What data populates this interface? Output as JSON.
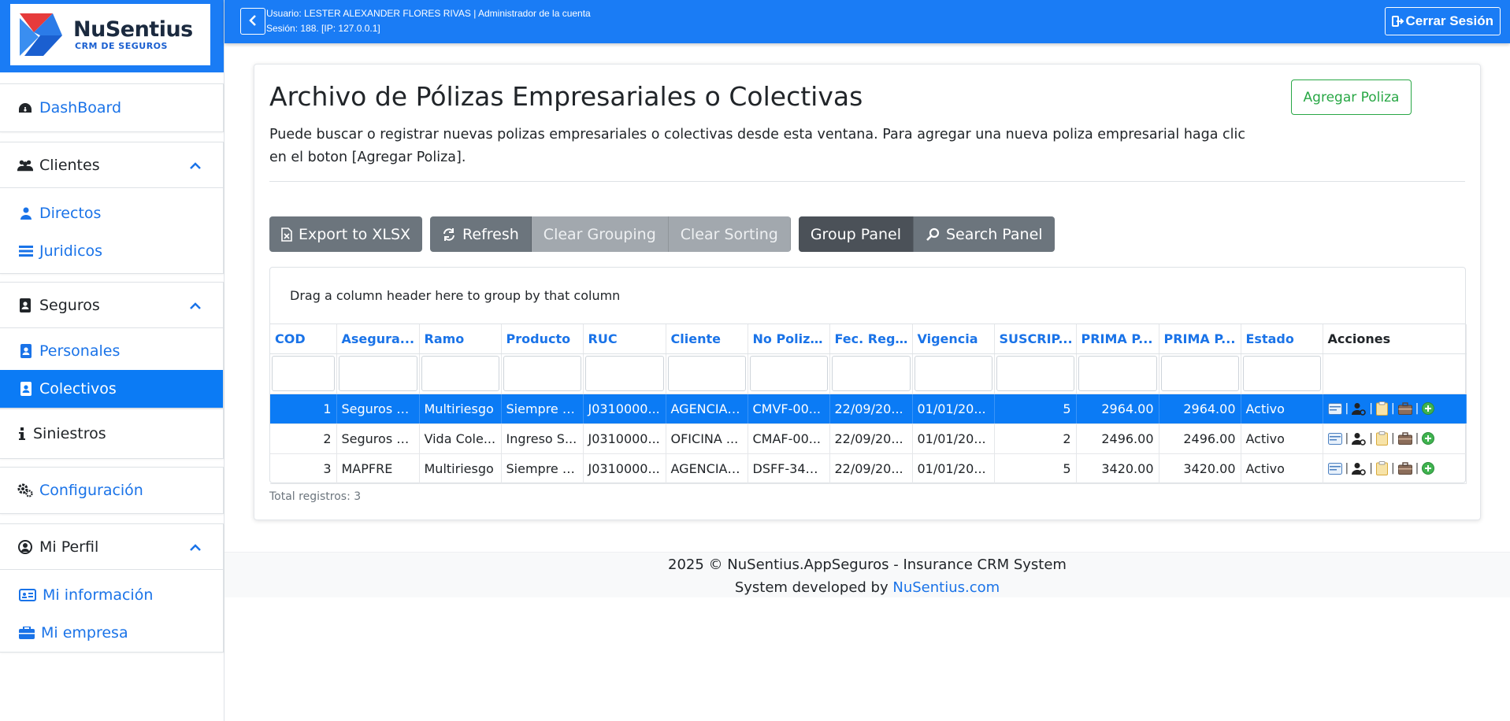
{
  "brand": {
    "name": "NuSentius",
    "tagline": "CRM DE SEGUROS"
  },
  "colors": {
    "primary": "#1a7cf5",
    "active": "#0b7bf5",
    "success": "#28a745",
    "link": "#1a73e8"
  },
  "sidebar": {
    "dashboard": {
      "label": "DashBoard",
      "icon": "dashboard-icon"
    },
    "clientes": {
      "label": "Clientes",
      "icon": "users-icon",
      "items": [
        {
          "label": "Directos",
          "icon": "user-icon"
        },
        {
          "label": "Juridicos",
          "icon": "list-icon"
        }
      ]
    },
    "seguros": {
      "label": "Seguros",
      "icon": "contact-book-icon",
      "items": [
        {
          "label": "Personales",
          "icon": "person-badge-icon"
        },
        {
          "label": "Colectivos",
          "icon": "person-badge-icon",
          "active": true
        }
      ]
    },
    "siniestros": {
      "label": "Siniestros",
      "icon": "info-icon"
    },
    "configuracion": {
      "label": "Configuración",
      "icon": "gears-icon"
    },
    "perfil": {
      "label": "Mi Perfil",
      "icon": "user-circle-icon",
      "items": [
        {
          "label": "Mi información",
          "icon": "id-card-icon"
        },
        {
          "label": "Mi empresa",
          "icon": "briefcase-icon"
        }
      ]
    }
  },
  "topbar": {
    "user_line": "Usuario: LESTER ALEXANDER FLORES RIVAS | Administrador de la cuenta",
    "session_line": "Sesión: 188. [IP: 127.0.0.1]",
    "logout_label": "Cerrar Sesión"
  },
  "main": {
    "title": "Archivo de Pólizas Empresariales o Colectivas",
    "description": "Puede buscar o registrar nuevas polizas empresariales o colectivas desde esta ventana. Para agregar una nueva poliza empresarial haga clic en el boton [Agregar Poliza].",
    "add_button": "Agregar Poliza",
    "toolbar": {
      "export": "Export to XLSX",
      "refresh": "Refresh",
      "clear_grouping": "Clear Grouping",
      "clear_sorting": "Clear Sorting",
      "group_panel": "Group Panel",
      "search_panel": "Search Panel"
    },
    "group_panel_text": "Drag a column header here to group by that column",
    "columns": [
      "COD",
      "Asegura...",
      "Ramo",
      "Producto",
      "RUC",
      "Cliente",
      "No Poliza...",
      "Fec. Regi...",
      "Vigencia",
      "SUSCRIP...",
      "PRIMA P...",
      "PRIMA P...",
      "Estado",
      "Acciones"
    ],
    "rows": [
      {
        "cod": "1",
        "aseguradora": "Seguros A...",
        "ramo": "Multiriesgo",
        "producto": "Siempre S...",
        "ruc": "J0310000...",
        "cliente": "AGENCIA ...",
        "poliza": "CMVF-00...",
        "fecha": "22/09/20...",
        "vigencia": "01/01/20...",
        "suscrip": "5",
        "prima1": "2964.00",
        "prima2": "2964.00",
        "estado": "Activo"
      },
      {
        "cod": "2",
        "aseguradora": "Seguros A...",
        "ramo": "Vida Cole...",
        "producto": "Ingreso S...",
        "ruc": "J0310000...",
        "cliente": "OFICINA ...",
        "poliza": "CMAF-00...",
        "fecha": "22/09/20...",
        "vigencia": "01/01/20...",
        "suscrip": "2",
        "prima1": "2496.00",
        "prima2": "2496.00",
        "estado": "Activo"
      },
      {
        "cod": "3",
        "aseguradora": "MAPFRE",
        "ramo": "Multiriesgo",
        "producto": "Siempre S...",
        "ruc": "J0310000...",
        "cliente": "AGENCIA ...",
        "poliza": "DSFF-345...",
        "fecha": "22/09/20...",
        "vigencia": "01/01/20...",
        "suscrip": "5",
        "prima1": "3420.00",
        "prima2": "3420.00",
        "estado": "Activo"
      }
    ],
    "action_icons": [
      "card-icon",
      "user-gear-icon",
      "clipboard-icon",
      "briefcase-icon",
      "add-circle-icon"
    ],
    "action_separator": "|",
    "total": "Total registros: 3"
  },
  "footer": {
    "line1": "2025 © NuSentius.AppSeguros - Insurance CRM System",
    "line2_prefix": "System developed by ",
    "line2_link": "NuSentius.com"
  }
}
